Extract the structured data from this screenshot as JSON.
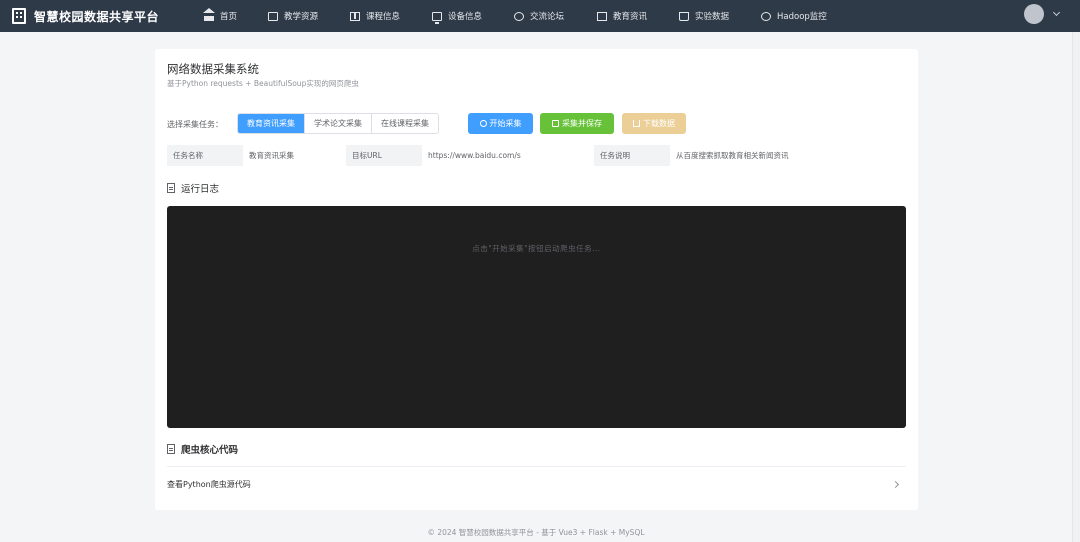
{
  "app": {
    "brand_title": "智慧校园数据共享平台"
  },
  "nav": {
    "items": [
      {
        "label": "首页",
        "icon": "home-icon"
      },
      {
        "label": "教学资源",
        "icon": "folder-icon"
      },
      {
        "label": "课程信息",
        "icon": "book-icon"
      },
      {
        "label": "设备信息",
        "icon": "monitor-icon"
      },
      {
        "label": "交流论坛",
        "icon": "chat-icon"
      },
      {
        "label": "教育资讯",
        "icon": "document-icon"
      },
      {
        "label": "实验数据",
        "icon": "cart-icon"
      },
      {
        "label": "Hadoop监控",
        "icon": "gauge-icon"
      }
    ]
  },
  "page": {
    "title": "网络数据采集系统",
    "subtitle": "基于Python requests + BeautifulSoup实现的网页爬虫"
  },
  "tasks": {
    "label": "选择采集任务：",
    "options": [
      "教育资讯采集",
      "学术论文采集",
      "在线课程采集"
    ],
    "selected": "教育资讯采集"
  },
  "actions": {
    "start": "开始采集",
    "save": "采集并保存",
    "download": "下载数据"
  },
  "info": {
    "name_key": "任务名称",
    "name_value": "教育资讯采集",
    "url_key": "目标URL",
    "url_value": "https://www.baidu.com/s",
    "desc_key": "任务说明",
    "desc_value": "从百度搜索抓取教育相关新闻资讯"
  },
  "log": {
    "title": "运行日志",
    "placeholder": "点击\"开始采集\"按钮启动爬虫任务..."
  },
  "code": {
    "title": "爬虫核心代码",
    "collapse_label": "查看Python爬虫源代码"
  },
  "footer": {
    "text": "© 2024 智慧校园数据共享平台 - 基于 Vue3 + Flask + MySQL"
  }
}
